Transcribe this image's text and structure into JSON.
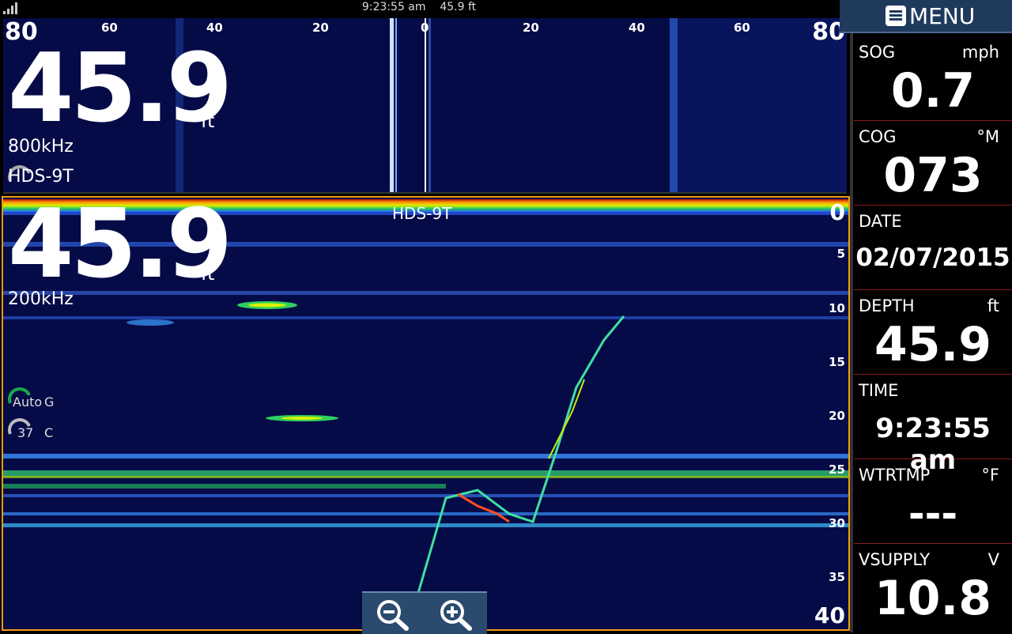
{
  "status": {
    "time": "9:23:55 am",
    "depth": "45.9 ft"
  },
  "menu": {
    "label": "MENU"
  },
  "sidescan": {
    "left_edge": "80",
    "right_edge": "80",
    "ticks": [
      "60",
      "40",
      "20",
      "0",
      "20",
      "40",
      "60"
    ],
    "depth": "45.9",
    "unit": "ft",
    "freq": "800kHz",
    "source": "HDS-9T"
  },
  "sonar": {
    "depth": "45.9",
    "unit": "ft",
    "freq": "200kHz",
    "source": "HDS-9T",
    "depth_ticks": [
      "0",
      "5",
      "10",
      "15",
      "20",
      "25",
      "30",
      "35",
      "40"
    ],
    "gain_mode": "Auto",
    "gain_label": "G",
    "contrast_value": "37",
    "contrast_label": "C"
  },
  "data_panel": [
    {
      "name": "SOG",
      "unit": "mph",
      "value": "0.7"
    },
    {
      "name": "COG",
      "unit": "°M",
      "value": "073"
    },
    {
      "name": "DATE",
      "unit": "",
      "value": "02/07/2015"
    },
    {
      "name": "DEPTH",
      "unit": "ft",
      "value": "45.9"
    },
    {
      "name": "TIME",
      "unit": "",
      "value": "9:23:55 am"
    },
    {
      "name": "WTRTMP",
      "unit": "°F",
      "value": "---"
    },
    {
      "name": "VSUPPLY",
      "unit": "V",
      "value": "10.8"
    }
  ],
  "zoom": {
    "out_icon": "zoom-out-icon",
    "in_icon": "zoom-in-icon"
  },
  "colors": {
    "water": "#050b47",
    "accent": "#f39a12",
    "menu": "#1f3a5c"
  }
}
